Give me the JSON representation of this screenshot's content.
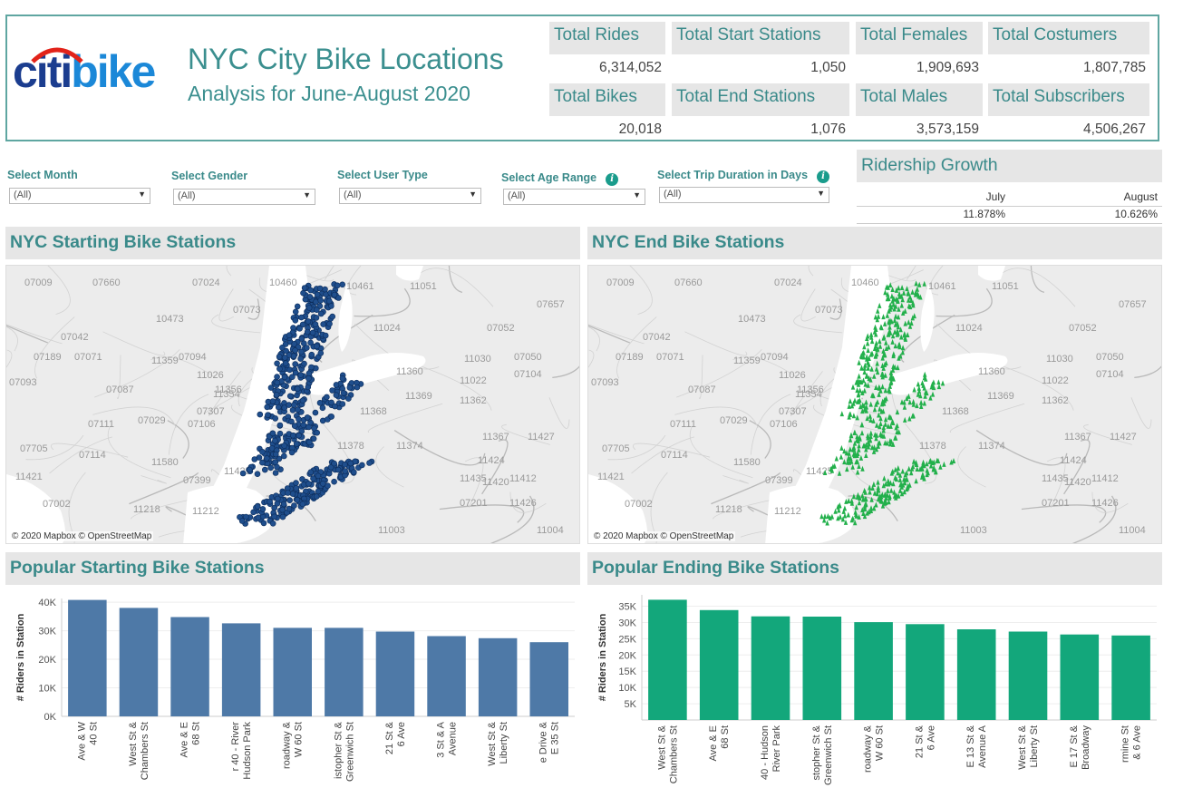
{
  "header": {
    "logo_left": "citi",
    "logo_right": "bike",
    "title": "NYC City Bike Locations",
    "subtitle": "Analysis for June-August 2020"
  },
  "kpis": [
    {
      "label": "Total Rides",
      "value": "6,314,052"
    },
    {
      "label": "Total Start Stations",
      "value": "1,050"
    },
    {
      "label": "Total Females",
      "value": "1,909,693"
    },
    {
      "label": "Total Costumers",
      "value": "1,807,785"
    },
    {
      "label": "Total Bikes",
      "value": "20,018"
    },
    {
      "label": "Total End Stations",
      "value": "1,076"
    },
    {
      "label": "Total Males",
      "value": "3,573,159"
    },
    {
      "label": "Total Subscribers",
      "value": "4,506,267"
    }
  ],
  "filters": [
    {
      "label": "Select Month",
      "value": "(All)"
    },
    {
      "label": "Select Gender",
      "value": "(All)"
    },
    {
      "label": "Select User Type",
      "value": "(All)"
    },
    {
      "label": "Select Age Range",
      "value": "(All)",
      "info": "i"
    },
    {
      "label": "Select Trip Duration in Days",
      "value": "(All)",
      "info": "i"
    }
  ],
  "growth": {
    "title": "Ridership Growth",
    "months": [
      "July",
      "August"
    ],
    "values": [
      "11.878%",
      "10.626%"
    ]
  },
  "maps": {
    "start_title": "NYC Starting Bike Stations",
    "end_title": "NYC End Bike Stations",
    "credit": "© 2020 Mapbox © OpenStreetMap",
    "start_color": "#1f4e8c",
    "end_color": "#22b04b",
    "zip_labels": [
      "07009",
      "07660",
      "07024",
      "10460",
      "10461",
      "11051",
      "07657",
      "07073",
      "10473",
      "11024",
      "07052",
      "07042",
      "07189",
      "07071",
      "07094",
      "11359",
      "11026",
      "11030",
      "07050",
      "07093",
      "11356",
      "11360",
      "11022",
      "07104",
      "07087",
      "11354",
      "11369",
      "11362",
      "07307",
      "07029",
      "11368",
      "07111",
      "07106",
      "11367",
      "11427",
      "07705",
      "11378",
      "11374",
      "07114",
      "11424",
      "11435",
      "11412",
      "11421",
      "11420",
      "11425",
      "11580",
      "07201",
      "07002",
      "11212",
      "11218",
      "07399",
      "11003",
      "11426",
      "11004"
    ]
  },
  "chart_data": [
    {
      "type": "bar",
      "title": "Popular Starting Bike Stations",
      "ylabel": "# Riders in Station",
      "color": "#4e79a7",
      "yticks": [
        "40K",
        "30K",
        "20K",
        "10K",
        "0K"
      ],
      "categories": [
        "Ave & W 40 St",
        "West St & Chambers St",
        "Ave & E 68 St",
        "r 40 - Hudson River Park",
        "roadway & W 60 St",
        "istopher St & Greenwich St",
        "21 St & 6 Ave",
        "3 St & Avenue A",
        "West St & Liberty St",
        "e Drive & E 35 St"
      ],
      "values": [
        40800,
        38000,
        34800,
        32600,
        31000,
        31000,
        29700,
        28100,
        27400,
        26000
      ]
    },
    {
      "type": "bar",
      "title": "Popular Ending Bike Stations",
      "ylabel": "# Riders in Station",
      "color": "#13a77b",
      "yticks": [
        "35K",
        "30K",
        "25K",
        "20K",
        "15K",
        "10K",
        "5K"
      ],
      "categories": [
        "West St & Chambers St",
        "Ave & E 68 St",
        "40 - Hudson River Park",
        "stopher St & Greenwich St",
        "roadway & W 60 St",
        "21 St & 6 Ave",
        "E 13 St & Avenue A",
        "West St & Liberty St",
        "E 17 St & Broadway",
        "rmine St & 6 Ave"
      ],
      "values": [
        37000,
        33800,
        31900,
        31800,
        30100,
        29500,
        27900,
        27200,
        26300,
        26000
      ]
    }
  ]
}
